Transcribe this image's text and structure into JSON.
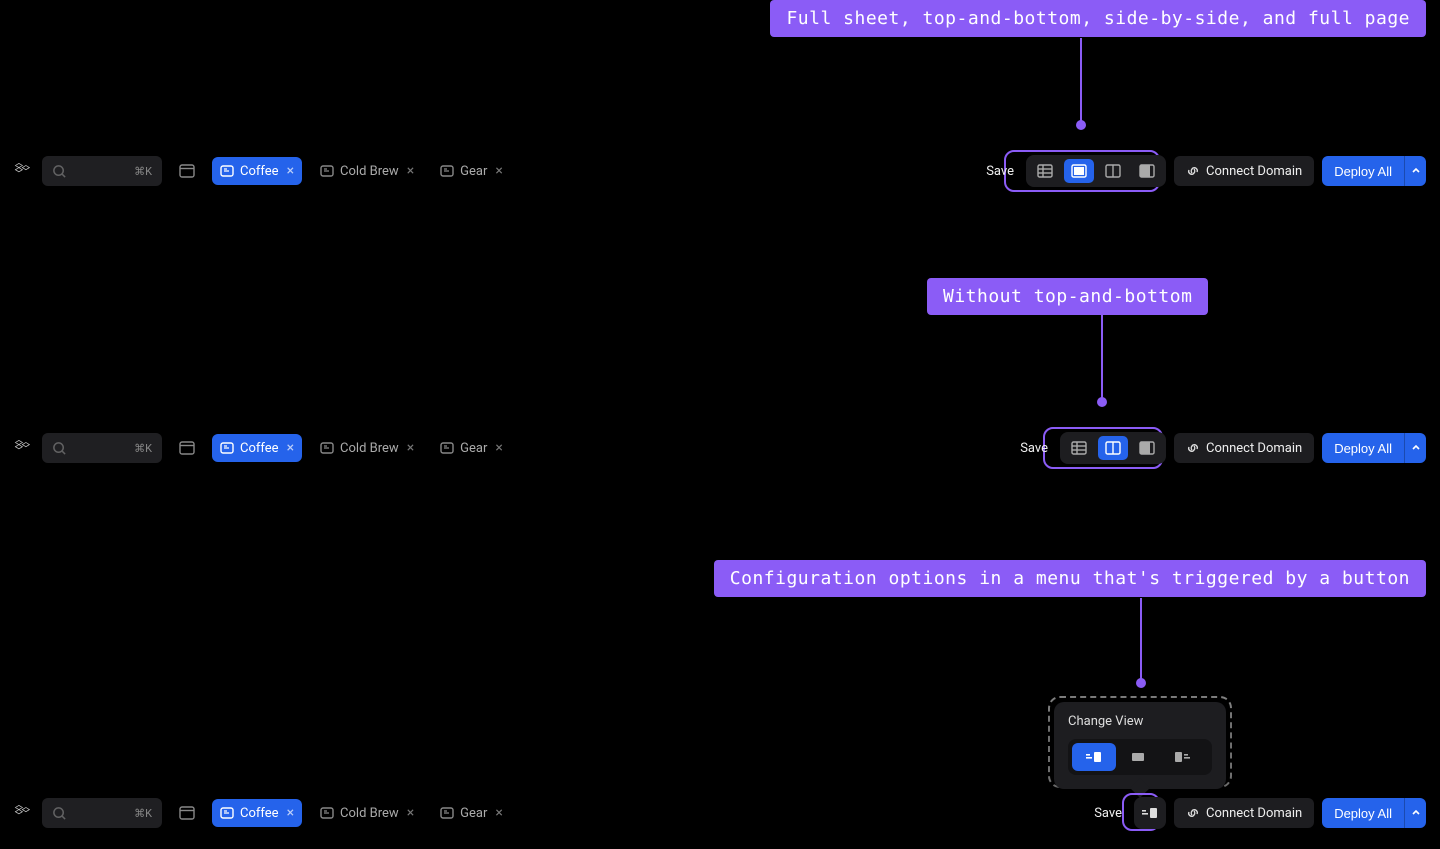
{
  "callouts": {
    "top": "Full sheet, top-and-bottom, side-by-side, and full page",
    "mid": "Without top-and-bottom",
    "bottom": "Configuration options in a menu that's triggered by a button"
  },
  "search": {
    "shortcut": "⌘K"
  },
  "tabs": [
    {
      "label": "Coffee",
      "active": true
    },
    {
      "label": "Cold Brew",
      "active": false
    },
    {
      "label": "Gear",
      "active": false
    }
  ],
  "actions": {
    "save": "Save",
    "connect": "Connect Domain",
    "deploy": "Deploy All"
  },
  "popover": {
    "title": "Change View"
  }
}
